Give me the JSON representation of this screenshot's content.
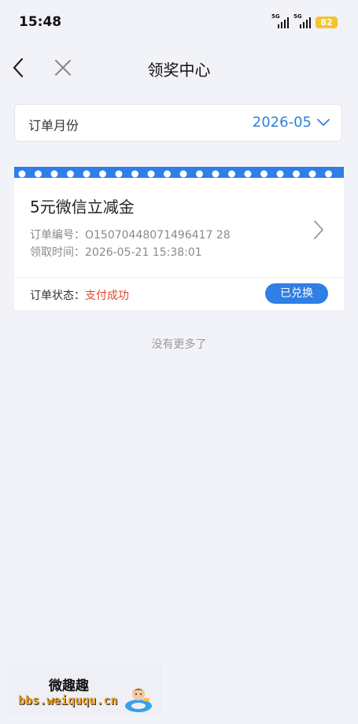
{
  "status_bar": {
    "time": "15:48",
    "network1": "5G",
    "network2": "5G",
    "battery": "82"
  },
  "nav": {
    "title": "领奖中心"
  },
  "month_selector": {
    "label": "订单月份",
    "value": "2026-05"
  },
  "order": {
    "title": "5元微信立减金",
    "order_no_label": "订单编号：",
    "order_no": "O15070448071496417 28",
    "claim_time_label": "领取时间：",
    "claim_time": "2026-05-21 15:38:01",
    "status_label": "订单状态：",
    "status_value": "支付成功",
    "action_label": "已兑换"
  },
  "footer_text": "没有更多了",
  "watermark": {
    "brand": "微趣趣",
    "url": "bbs.weiququ.cn"
  },
  "colors": {
    "accent": "#2f7fe4",
    "status_red": "#e5482e",
    "battery": "#f4c430"
  }
}
